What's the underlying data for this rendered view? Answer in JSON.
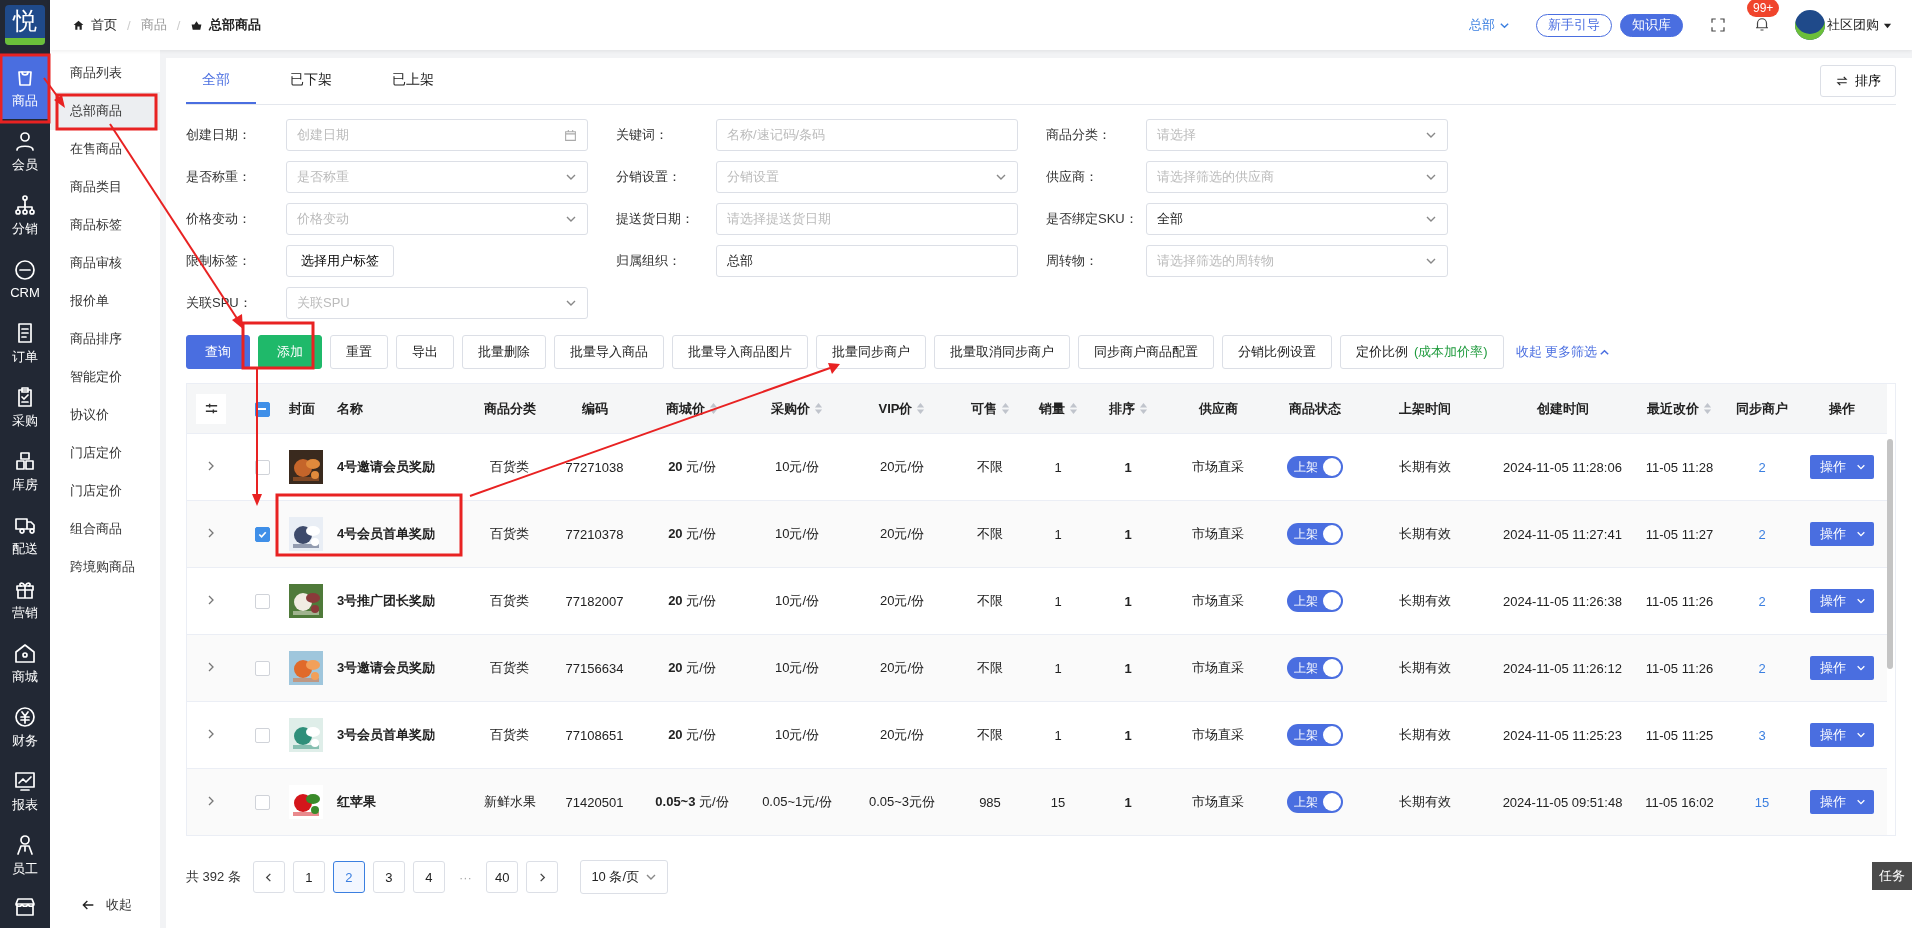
{
  "logo": {
    "text": "悦"
  },
  "rail": [
    {
      "label": "商品",
      "selected": true
    },
    {
      "label": "会员",
      "selected": false
    },
    {
      "label": "分销",
      "selected": false
    },
    {
      "label": "CRM",
      "selected": false
    },
    {
      "label": "订单",
      "selected": false
    },
    {
      "label": "采购",
      "selected": false
    },
    {
      "label": "库房",
      "selected": false
    },
    {
      "label": "配送",
      "selected": false
    },
    {
      "label": "营销",
      "selected": false
    },
    {
      "label": "商城",
      "selected": false
    },
    {
      "label": "财务",
      "selected": false
    },
    {
      "label": "报表",
      "selected": false
    },
    {
      "label": "员工",
      "selected": false
    }
  ],
  "breadcrumb": {
    "items": [
      "首页",
      "商品",
      "总部商品"
    ],
    "separator": "/"
  },
  "topbar": {
    "org": "总部",
    "guide": "新手引导",
    "knowledge": "知识库",
    "badge": "99+",
    "user": "社区团购"
  },
  "submenu": [
    {
      "label": "商品列表",
      "selected": false
    },
    {
      "label": "总部商品",
      "selected": true
    },
    {
      "label": "在售商品",
      "selected": false
    },
    {
      "label": "商品类目",
      "selected": false
    },
    {
      "label": "商品标签",
      "selected": false
    },
    {
      "label": "商品审核",
      "selected": false
    },
    {
      "label": "报价单",
      "selected": false
    },
    {
      "label": "商品排序",
      "selected": false
    },
    {
      "label": "智能定价",
      "selected": false
    },
    {
      "label": "协议价",
      "selected": false
    },
    {
      "label": "门店定价",
      "selected": false
    },
    {
      "label": "门店定价",
      "selected": false
    },
    {
      "label": "组合商品",
      "selected": false
    },
    {
      "label": "跨境购商品",
      "selected": false
    }
  ],
  "collapse": "收起",
  "tabs": [
    {
      "label": "全部",
      "selected": true
    },
    {
      "label": "已下架",
      "selected": false
    },
    {
      "label": "已上架",
      "selected": false
    }
  ],
  "sort_button": "排序",
  "filters": [
    {
      "label": "创建日期：",
      "kind": "date",
      "placeholder": "创建日期"
    },
    {
      "label": "关键词：",
      "kind": "input",
      "placeholder": "名称/速记码/条码"
    },
    {
      "label": "商品分类：",
      "kind": "select",
      "placeholder": "请选择"
    },
    {
      "label": "是否称重：",
      "kind": "select",
      "placeholder": "是否称重"
    },
    {
      "label": "分销设置：",
      "kind": "select",
      "placeholder": "分销设置"
    },
    {
      "label": "供应商：",
      "kind": "select",
      "placeholder": "请选择筛选的供应商"
    },
    {
      "label": "价格变动：",
      "kind": "select",
      "placeholder": "价格变动"
    },
    {
      "label": "提送货日期：",
      "kind": "input",
      "placeholder": "请选择提送货日期"
    },
    {
      "label": "是否绑定SKU：",
      "kind": "select",
      "value": "全部"
    },
    {
      "label": "限制标签：",
      "kind": "button",
      "value": "选择用户标签"
    },
    {
      "label": "归属组织：",
      "kind": "input",
      "value": "总部"
    },
    {
      "label": "周转物：",
      "kind": "select",
      "placeholder": "请选择筛选的周转物"
    },
    {
      "label": "关联SPU：",
      "kind": "select",
      "placeholder": "关联SPU"
    }
  ],
  "actions": [
    {
      "label": "查询",
      "kind": "primary"
    },
    {
      "label": "添加",
      "kind": "success"
    },
    {
      "label": "重置",
      "kind": "default"
    },
    {
      "label": "导出",
      "kind": "default"
    },
    {
      "label": "批量删除",
      "kind": "default"
    },
    {
      "label": "批量导入商品",
      "kind": "default"
    },
    {
      "label": "批量导入商品图片",
      "kind": "default"
    },
    {
      "label": "批量同步商户",
      "kind": "default"
    },
    {
      "label": "批量取消同步商户",
      "kind": "default"
    },
    {
      "label": "同步商户商品配置",
      "kind": "default"
    },
    {
      "label": "分销比例设置",
      "kind": "default"
    },
    {
      "label": "定价比例",
      "note": "(成本加价率)",
      "kind": "default"
    }
  ],
  "more_filters": "收起 更多筛选",
  "table": {
    "header_checkbox": {
      "indeterminate": true
    },
    "columns": [
      {
        "label": "封面",
        "sortable": false
      },
      {
        "label": "名称",
        "sortable": false
      },
      {
        "label": "商品分类",
        "sortable": false
      },
      {
        "label": "编码",
        "sortable": false
      },
      {
        "label": "商城价",
        "sortable": true
      },
      {
        "label": "采购价",
        "sortable": true
      },
      {
        "label": "VIP价",
        "sortable": true
      },
      {
        "label": "可售",
        "sortable": true
      },
      {
        "label": "销量",
        "sortable": true
      },
      {
        "label": "排序",
        "sortable": true
      },
      {
        "label": "供应商",
        "sortable": false
      },
      {
        "label": "商品状态",
        "sortable": false
      },
      {
        "label": "上架时间",
        "sortable": false
      },
      {
        "label": "创建时间",
        "sortable": false
      },
      {
        "label": "最近改价",
        "sortable": true
      },
      {
        "label": "同步商户",
        "sortable": false
      },
      {
        "label": "操作",
        "sortable": false
      }
    ],
    "rows": [
      {
        "checked": false,
        "name": "4号邀请会员奖励",
        "category": "百货类",
        "code": "77271038",
        "mall_price": "**20** 元/份",
        "purchase_price": "10元/份",
        "vip_price": "20元/份",
        "available": "不限",
        "sales": "1",
        "sort": "1",
        "supplier": "市场直采",
        "status": {
          "label": "上架",
          "on": true
        },
        "shelf_time": "长期有效",
        "created": "2024-11-05 11:28:06",
        "price_changed": "11-05 11:28",
        "sync": "2",
        "action": "操作"
      },
      {
        "checked": true,
        "name": "4号会员首单奖励",
        "category": "百货类",
        "code": "77210378",
        "mall_price": "**20** 元/份",
        "purchase_price": "10元/份",
        "vip_price": "20元/份",
        "available": "不限",
        "sales": "1",
        "sort": "1",
        "supplier": "市场直采",
        "status": {
          "label": "上架",
          "on": true
        },
        "shelf_time": "长期有效",
        "created": "2024-11-05 11:27:41",
        "price_changed": "11-05 11:27",
        "sync": "2",
        "action": "操作"
      },
      {
        "checked": false,
        "name": "3号推广团长奖励",
        "category": "百货类",
        "code": "77182007",
        "mall_price": "**20** 元/份",
        "purchase_price": "10元/份",
        "vip_price": "20元/份",
        "available": "不限",
        "sales": "1",
        "sort": "1",
        "supplier": "市场直采",
        "status": {
          "label": "上架",
          "on": true
        },
        "shelf_time": "长期有效",
        "created": "2024-11-05 11:26:38",
        "price_changed": "11-05 11:26",
        "sync": "2",
        "action": "操作"
      },
      {
        "checked": false,
        "name": "3号邀请会员奖励",
        "category": "百货类",
        "code": "77156634",
        "mall_price": "**20** 元/份",
        "purchase_price": "10元/份",
        "vip_price": "20元/份",
        "available": "不限",
        "sales": "1",
        "sort": "1",
        "supplier": "市场直采",
        "status": {
          "label": "上架",
          "on": true
        },
        "shelf_time": "长期有效",
        "created": "2024-11-05 11:26:12",
        "price_changed": "11-05 11:26",
        "sync": "2",
        "action": "操作"
      },
      {
        "checked": false,
        "name": "3号会员首单奖励",
        "category": "百货类",
        "code": "77108651",
        "mall_price": "**20** 元/份",
        "purchase_price": "10元/份",
        "vip_price": "20元/份",
        "available": "不限",
        "sales": "1",
        "sort": "1",
        "supplier": "市场直采",
        "status": {
          "label": "上架",
          "on": true
        },
        "shelf_time": "长期有效",
        "created": "2024-11-05 11:25:23",
        "price_changed": "11-05 11:25",
        "sync": "3",
        "action": "操作"
      },
      {
        "checked": false,
        "name": "红苹果",
        "category": "新鲜水果",
        "code": "71420501",
        "mall_price": "**0.05~3** 元/份",
        "purchase_price": "0.05~1元/份",
        "vip_price": "0.05~3元份",
        "available": "985",
        "sales": "15",
        "sort": "1",
        "supplier": "市场直采",
        "status": {
          "label": "上架",
          "on": true
        },
        "shelf_time": "长期有效",
        "created": "2024-11-05 09:51:48",
        "price_changed": "11-05 16:02",
        "sync": "15",
        "action": "操作"
      }
    ]
  },
  "pagination": {
    "total": "共 392 条",
    "pages": [
      {
        "label": "1",
        "selected": false
      },
      {
        "label": "2",
        "selected": true
      },
      {
        "label": "3",
        "selected": false
      },
      {
        "label": "4",
        "selected": false
      },
      {
        "label": "···",
        "kind": "ellipsis",
        "selected": false
      },
      {
        "label": "40",
        "selected": false
      }
    ],
    "page_size": "10 条/页"
  },
  "task_tab": "任务"
}
